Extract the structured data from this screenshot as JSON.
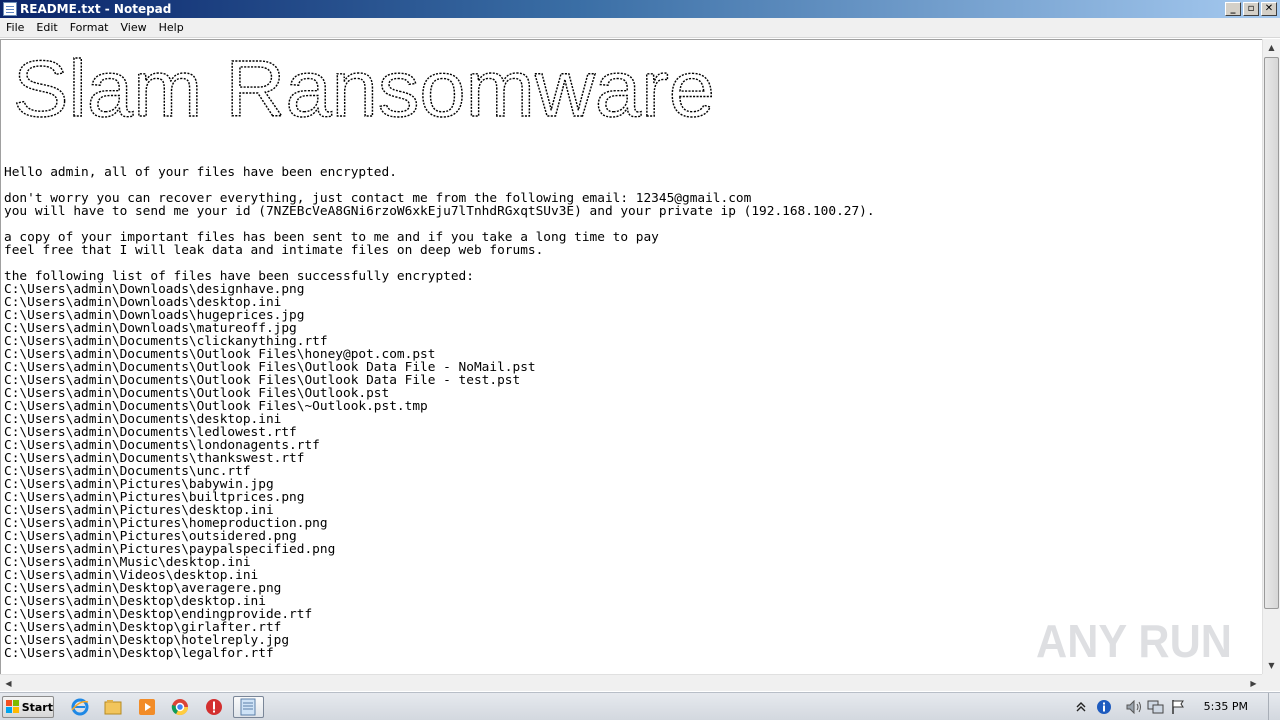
{
  "window": {
    "title": "README.txt - Notepad",
    "controls": {
      "minimize": "_",
      "maximize": "▫",
      "close": "✕"
    }
  },
  "menu": [
    "File",
    "Edit",
    "Format",
    "View",
    "Help"
  ],
  "banner": "Slam Ransomware",
  "document": {
    "lines": [
      "Hello admin, all of your files have been encrypted.",
      "",
      "don't worry you can recover everything, just contact me from the following email: 12345@gmail.com",
      "you will have to send me your id (7NZEBcVeA8GNi6rzoW6xkEju7lTnhdRGxqtSUv3E) and your private ip (192.168.100.27).",
      "",
      "a copy of your important files has been sent to me and if you take a long time to pay",
      "feel free that I will leak data and intimate files on deep web forums.",
      "",
      "the following list of files have been successfully encrypted:",
      "C:\\Users\\admin\\Downloads\\designhave.png",
      "C:\\Users\\admin\\Downloads\\desktop.ini",
      "C:\\Users\\admin\\Downloads\\hugeprices.jpg",
      "C:\\Users\\admin\\Downloads\\matureoff.jpg",
      "C:\\Users\\admin\\Documents\\clickanything.rtf",
      "C:\\Users\\admin\\Documents\\Outlook Files\\honey@pot.com.pst",
      "C:\\Users\\admin\\Documents\\Outlook Files\\Outlook Data File - NoMail.pst",
      "C:\\Users\\admin\\Documents\\Outlook Files\\Outlook Data File - test.pst",
      "C:\\Users\\admin\\Documents\\Outlook Files\\Outlook.pst",
      "C:\\Users\\admin\\Documents\\Outlook Files\\~Outlook.pst.tmp",
      "C:\\Users\\admin\\Documents\\desktop.ini",
      "C:\\Users\\admin\\Documents\\ledlowest.rtf",
      "C:\\Users\\admin\\Documents\\londonagents.rtf",
      "C:\\Users\\admin\\Documents\\thankswest.rtf",
      "C:\\Users\\admin\\Documents\\unc.rtf",
      "C:\\Users\\admin\\Pictures\\babywin.jpg",
      "C:\\Users\\admin\\Pictures\\builtprices.png",
      "C:\\Users\\admin\\Pictures\\desktop.ini",
      "C:\\Users\\admin\\Pictures\\homeproduction.png",
      "C:\\Users\\admin\\Pictures\\outsidered.png",
      "C:\\Users\\admin\\Pictures\\paypalspecified.png",
      "C:\\Users\\admin\\Music\\desktop.ini",
      "C:\\Users\\admin\\Videos\\desktop.ini",
      "C:\\Users\\admin\\Desktop\\averagere.png",
      "C:\\Users\\admin\\Desktop\\desktop.ini",
      "C:\\Users\\admin\\Desktop\\endingprovide.rtf",
      "C:\\Users\\admin\\Desktop\\girlafter.rtf",
      "C:\\Users\\admin\\Desktop\\hotelreply.jpg",
      "C:\\Users\\admin\\Desktop\\legalfor.rtf"
    ]
  },
  "watermark": "ANY RUN",
  "taskbar": {
    "start_label": "Start",
    "pinned": [
      "internet-explorer-icon",
      "file-explorer-icon",
      "media-player-icon",
      "chrome-icon",
      "security-alert-icon",
      "notepad-icon"
    ],
    "tray": [
      "show-hidden-icons",
      "info-icon",
      "volume-icon",
      "network-icon",
      "action-center-flag-icon"
    ],
    "clock": "5:35 PM"
  },
  "colors": {
    "titlebar_start": "#0a246a",
    "titlebar_end": "#a6caf0",
    "taskbar": "#d9dde3"
  }
}
